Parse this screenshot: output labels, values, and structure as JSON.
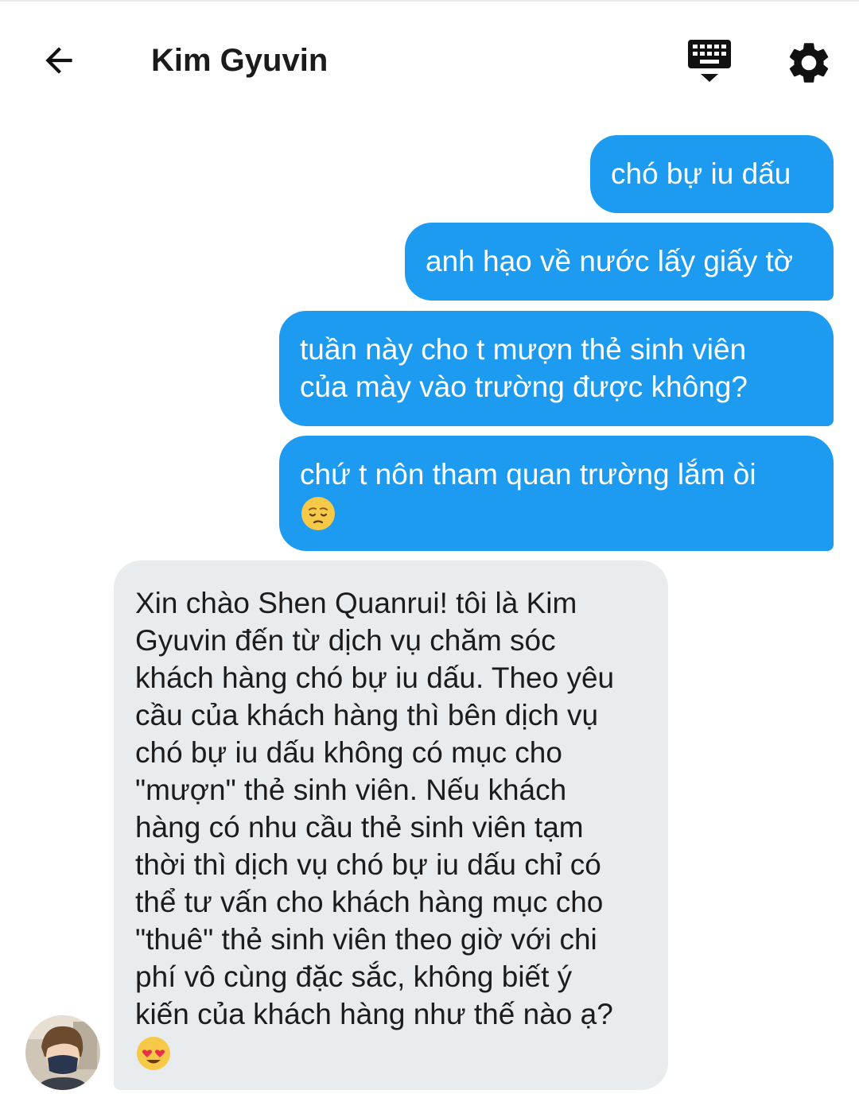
{
  "header": {
    "title": "Kim Gyuvin",
    "back_icon": "arrow-left-icon",
    "keyboard_icon": "keyboard-hide-icon",
    "settings_icon": "gear-icon"
  },
  "colors": {
    "outgoing_bubble": "#1d9bf0",
    "incoming_bubble": "#e9ecef",
    "outgoing_text": "#ffffff",
    "incoming_text": "#1c1c1c"
  },
  "messages": [
    {
      "direction": "outgoing",
      "text": "chó bự iu dấu"
    },
    {
      "direction": "outgoing",
      "text": "anh hạo về nước lấy giấy tờ"
    },
    {
      "direction": "outgoing",
      "lines": [
        "tuần này cho t mượn thẻ sinh viên",
        "của mày vào trường được không?"
      ]
    },
    {
      "direction": "outgoing",
      "text": "chứ t nôn tham quan trường lắm òi",
      "emoji": "pensive-face-emoji"
    },
    {
      "direction": "incoming",
      "lines": [
        "Xin chào Shen Quanrui! tôi là Kim",
        "Gyuvin đến từ dịch vụ chăm sóc",
        "khách hàng chó bự iu dấu. Theo yêu",
        "cầu của khách hàng thì bên dịch vụ",
        "chó bự iu dấu không có mục cho",
        "\"mượn\" thẻ sinh viên. Nếu khách",
        "hàng có nhu cầu thẻ sinh viên tạm",
        "thời thì dịch vụ chó bự iu dấu chỉ có",
        "thể tư vấn cho khách hàng mục cho",
        "\"thuê\" thẻ sinh viên theo giờ với chi",
        "phí vô cùng đặc sắc, không biết ý",
        "kiến của khách hàng như thế nào ạ?"
      ],
      "emoji": "heart-eyes-emoji",
      "avatar": "sender-avatar"
    }
  ]
}
